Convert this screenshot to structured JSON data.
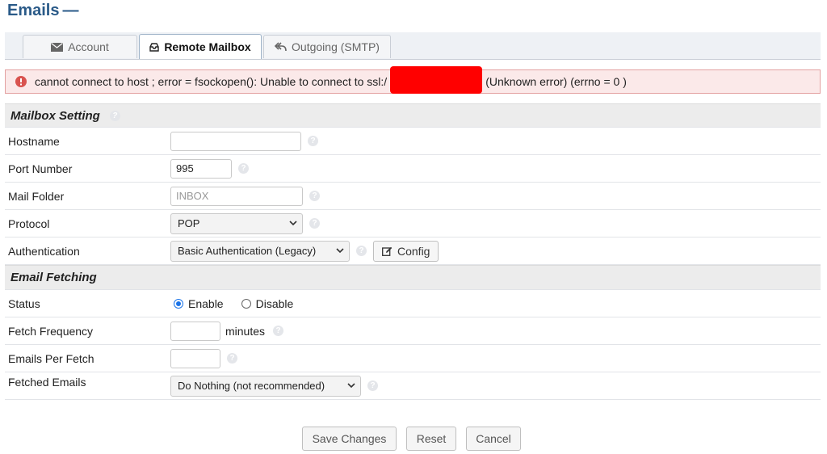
{
  "page": {
    "title": "Emails",
    "title_dash": "—"
  },
  "tabs": [
    {
      "label": "Account",
      "icon": "envelope-icon",
      "active": false
    },
    {
      "label": "Remote Mailbox",
      "icon": "inbox-tray-icon",
      "active": true
    },
    {
      "label": "Outgoing (SMTP)",
      "icon": "reply-arrow-icon",
      "active": false
    }
  ],
  "error": {
    "prefix": "cannot connect to host ; error = fsockopen(): Unable to connect to ssl:/",
    "suffix": "(Unknown error) (errno = 0 )",
    "icon": "error-circle-icon",
    "color": "#d9534f"
  },
  "mailbox_section": {
    "title": "Mailbox Setting"
  },
  "fields": {
    "hostname": {
      "label": "Hostname",
      "value": ""
    },
    "port": {
      "label": "Port Number",
      "value": "995"
    },
    "folder": {
      "label": "Mail Folder",
      "value": "",
      "placeholder": "INBOX"
    },
    "protocol": {
      "label": "Protocol",
      "selected": "POP"
    },
    "auth": {
      "label": "Authentication",
      "selected": "Basic Authentication (Legacy)",
      "config_label": "Config"
    }
  },
  "fetch_section": {
    "title": "Email Fetching"
  },
  "fetch": {
    "status": {
      "label": "Status",
      "enable": "Enable",
      "disable": "Disable",
      "selected": "Enable"
    },
    "frequency": {
      "label": "Fetch Frequency",
      "value": "",
      "unit": "minutes"
    },
    "per_fetch": {
      "label": "Emails Per Fetch",
      "value": ""
    },
    "fetched": {
      "label": "Fetched Emails",
      "selected": "Do Nothing (not recommended)"
    }
  },
  "actions": {
    "save": "Save Changes",
    "reset": "Reset",
    "cancel": "Cancel"
  },
  "colors": {
    "accent": "#2a5a88",
    "radio": "#1a73e8",
    "redaction": "#ff0000"
  }
}
